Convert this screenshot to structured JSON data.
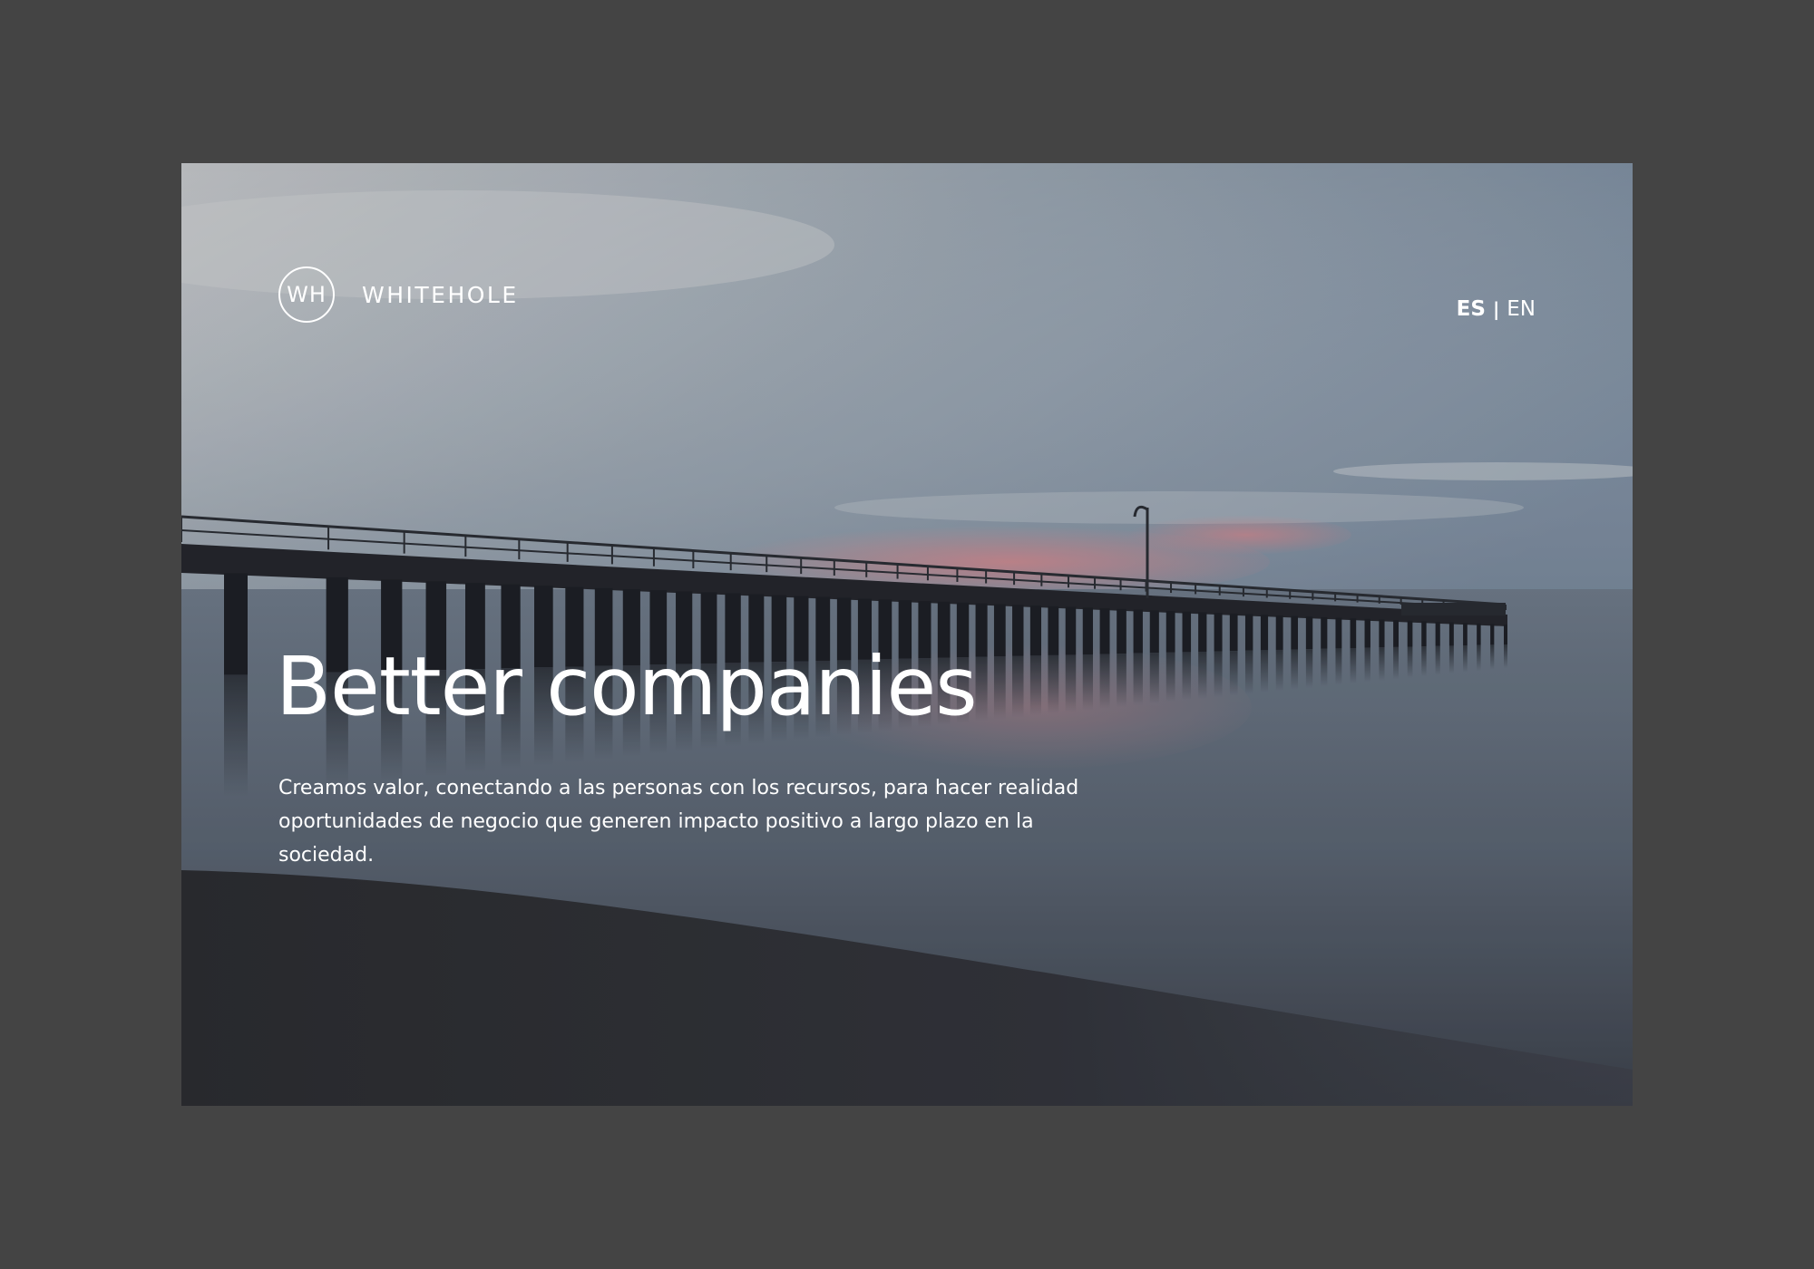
{
  "brand": {
    "logo_initials": "WH",
    "name": "WHITEHOLE"
  },
  "language": {
    "active": "ES",
    "separator": "|",
    "other": "EN"
  },
  "hero": {
    "headline": "Better companies",
    "description": "Creamos valor, conectando a las personas con los recursos, para hacer realidad oportunidades de negocio que generen impacto positivo a largo plazo en la sociedad.",
    "background_image": "pier-at-dusk-over-calm-sea"
  },
  "colors": {
    "page_background": "#444444",
    "text": "#ffffff",
    "sky_light": "#c2c5c9",
    "sky_blue": "#6f8297",
    "sunset_pink": "#d9868c",
    "water": "#6b7583",
    "shore_dark": "#2a2c31"
  }
}
